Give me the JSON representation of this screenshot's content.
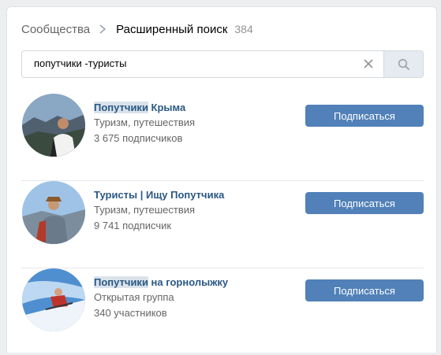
{
  "header": {
    "breadcrumb_root": "Сообщества",
    "title": "Расширенный поиск",
    "count": "384"
  },
  "search": {
    "value": "попутчики -туристы"
  },
  "results": [
    {
      "name_highlight": "Попутчики",
      "name_rest": " Крыма",
      "category": "Туризм, путешествия",
      "members": "3 675 подписчиков",
      "button": "Подписаться"
    },
    {
      "name_highlight": "",
      "name_rest": "Туристы | Ищу Попутчика",
      "category": "Туризм, путешествия",
      "members": "9 741 подписчик",
      "button": "Подписаться"
    },
    {
      "name_highlight": "Попутчики",
      "name_rest": " на горнолыжку",
      "category": "Открытая группа",
      "members": "340 участников",
      "button": "Подписаться"
    }
  ],
  "colors": {
    "accent": "#5181b8",
    "link": "#2a5885",
    "highlight": "#dae2ea"
  }
}
